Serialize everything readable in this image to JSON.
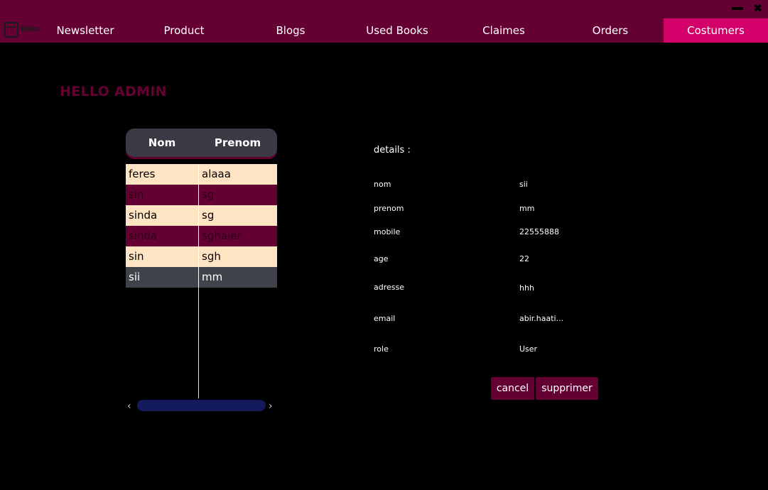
{
  "app": {
    "logo_text": "B8ks"
  },
  "window": {
    "minimize_icon": "minimize-icon",
    "close_icon": "close-icon",
    "close_glyph": "✖"
  },
  "nav": {
    "items": [
      {
        "label": "Newsletter"
      },
      {
        "label": "Product"
      },
      {
        "label": "Blogs"
      },
      {
        "label": "Used Books"
      },
      {
        "label": "Claimes"
      },
      {
        "label": "Orders"
      },
      {
        "label": "Costumers",
        "active": true
      }
    ]
  },
  "greeting": "HELLO ADMIN",
  "table": {
    "columns": [
      "Nom",
      "Prenom"
    ],
    "rows": [
      {
        "nom": "feres",
        "prenom": "alaaa"
      },
      {
        "nom": "sin",
        "prenom": "sg"
      },
      {
        "nom": "sinda",
        "prenom": "sg"
      },
      {
        "nom": "sinda",
        "prenom": "sghaier"
      },
      {
        "nom": "sin",
        "prenom": "sgh"
      },
      {
        "nom": "sii",
        "prenom": "mm",
        "selected": true
      }
    ],
    "scroll_left_glyph": "‹",
    "scroll_right_glyph": "›"
  },
  "details": {
    "title": "details :",
    "fields": [
      {
        "label": "nom",
        "value": "sii"
      },
      {
        "label": "prenom",
        "value": "mm"
      },
      {
        "label": "mobile",
        "value": "22555888"
      },
      {
        "label": "age",
        "value": "22"
      },
      {
        "label": "adresse",
        "value": "hhh"
      },
      {
        "label": "email",
        "value": "abir.haati..."
      },
      {
        "label": "role",
        "value": "User"
      }
    ]
  },
  "actions": {
    "cancel_label": "cancel",
    "delete_label": "supprimer"
  },
  "colors": {
    "brand": "#650033",
    "accent": "#d4006a",
    "row_light": "#ffe4c4",
    "row_selected": "#3f444a",
    "scroll_thumb": "#141b5c"
  }
}
